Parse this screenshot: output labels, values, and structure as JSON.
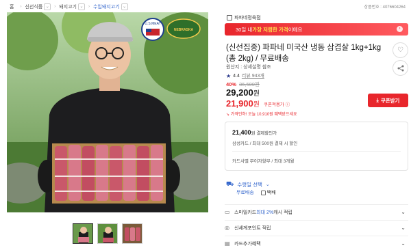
{
  "breadcrumb": {
    "home": "홈",
    "items": [
      "신선식품",
      "돼지고기",
      "수입돼지고기"
    ]
  },
  "product_no": "상품번호 : 4076604264",
  "images": {
    "badges": [
      "U.S.MEAT",
      "NEBRASKA"
    ],
    "thumbnail_count": 3
  },
  "store": {
    "name": "파파네정육점"
  },
  "promo": {
    "prefix": "30일 내 ",
    "highlight": "가장 저렴한 가격",
    "suffix": "이에요"
  },
  "title": "(신선집중) 파파네 미국산 냉동 삼겹살 1kg+1kg (총 2kg) / 무료배송",
  "origin": "원산지 : 상세설명 참조",
  "rating": {
    "score": "4.4",
    "reviews": "리뷰 943개"
  },
  "pricing": {
    "discount_pct": "40%",
    "original": "36,500원",
    "price": "29,200",
    "price_unit": "원",
    "coupon_price": "21,900",
    "coupon_unit": "원",
    "coupon_tag": "쿠폰적용가 ⓘ",
    "coupon_button": "쿠폰받기",
    "note": "가격인하! 오늘 10,910원 혜택받으세요"
  },
  "card": {
    "amount": "21,400",
    "amount_label": "원 결제할인가",
    "detail": "삼성카드 / 최대 500원 결제 시 할인",
    "installment": "카드사별 무이자할부 / 최대 3개월"
  },
  "shipping": {
    "label": "수령일 선택",
    "option_free": "무료배송",
    "option_courier": "택배"
  },
  "rows": [
    {
      "icon": "card-icon",
      "prefix": "스마일카드 ",
      "highlight": "최대 2%",
      "suffix": " 캐시 적립"
    },
    {
      "icon": "coin-icon",
      "prefix": "신세계포인트 적립",
      "highlight": "",
      "suffix": ""
    },
    {
      "icon": "wallet-icon",
      "prefix": "카드추가혜택",
      "highlight": "",
      "suffix": ""
    }
  ],
  "colors": {
    "accent_red": "#e8262c",
    "link_blue": "#3366cc"
  }
}
